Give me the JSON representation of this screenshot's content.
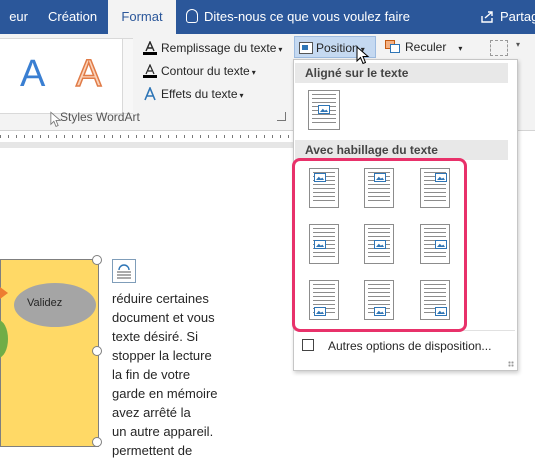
{
  "tabs": {
    "prev": "eur",
    "creation": "Création",
    "format": "Format",
    "tell_me": "Dites-nous ce que vous voulez faire",
    "share": "Partag"
  },
  "ribbon": {
    "wordart_letter_1": "A",
    "wordart_letter_2": "A",
    "fill": "Remplissage du texte",
    "outline": "Contour du texte",
    "effects": "Effets du texte",
    "group_label": "Styles WordArt",
    "position": "Position",
    "send_backward": "Reculer"
  },
  "panel": {
    "inline_header": "Aligné sur le texte",
    "wrap_header": "Avec habillage du texte",
    "more_options": "Autres options de disposition..."
  },
  "document": {
    "shape_label": "Validez",
    "lines": [
      "réduire certaines",
      "document et vous",
      "texte désiré. Si",
      "stopper la lecture",
      "la fin de votre",
      "garde en mémoire",
      "avez arrêté la",
      "un autre appareil.",
      "permettent de"
    ]
  },
  "colors": {
    "title_bar": "#2b579a",
    "highlight_border": "#e8316a",
    "shape_fill": "#ffd966",
    "selected_button": "#c5d9f1"
  }
}
